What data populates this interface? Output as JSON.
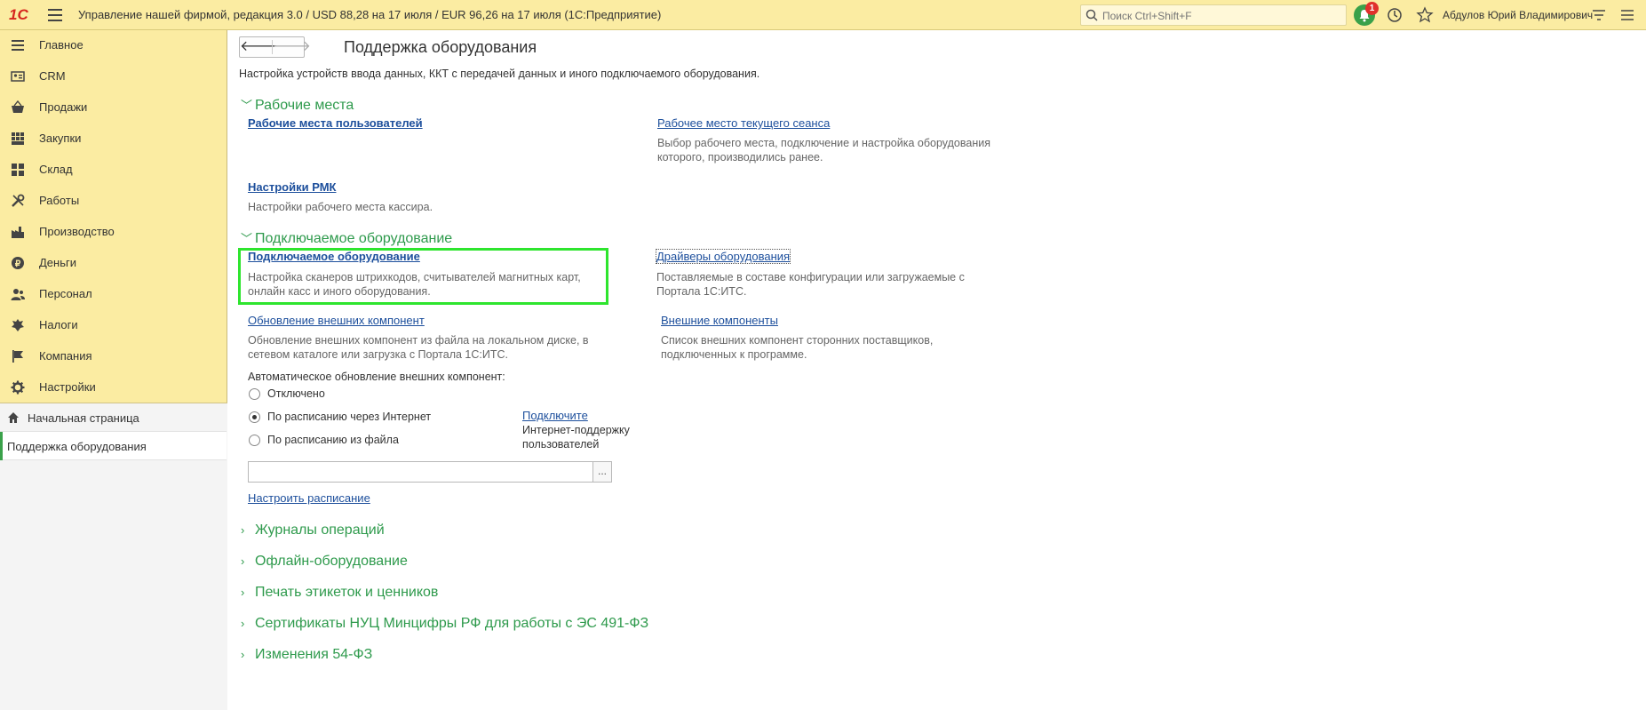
{
  "app": {
    "logo": "1С",
    "title": "Управление нашей фирмой, редакция 3.0 / USD 88,28 на 17 июля / EUR 96,26 на 17 июля  (1С:Предприятие)",
    "search_placeholder": "Поиск Ctrl+Shift+F",
    "notification_count": "1",
    "user": "Абдулов Юрий Владимирович"
  },
  "sidebar": {
    "items": [
      {
        "label": "Главное",
        "icon": "menu-icon"
      },
      {
        "label": "CRM",
        "icon": "crm-icon"
      },
      {
        "label": "Продажи",
        "icon": "sales-icon"
      },
      {
        "label": "Закупки",
        "icon": "purchases-icon"
      },
      {
        "label": "Склад",
        "icon": "warehouse-icon"
      },
      {
        "label": "Работы",
        "icon": "tools-icon"
      },
      {
        "label": "Производство",
        "icon": "factory-icon"
      },
      {
        "label": "Деньги",
        "icon": "money-icon"
      },
      {
        "label": "Персонал",
        "icon": "people-icon"
      },
      {
        "label": "Налоги",
        "icon": "taxes-icon"
      },
      {
        "label": "Компания",
        "icon": "flag-icon"
      },
      {
        "label": "Настройки",
        "icon": "gear-icon"
      }
    ],
    "open_pages": [
      {
        "label": "Начальная страница"
      },
      {
        "label": "Поддержка оборудования"
      }
    ]
  },
  "page": {
    "title": "Поддержка оборудования",
    "description": "Настройка устройств ввода данных, ККТ с передачей данных и иного подключаемого оборудования.",
    "groups": {
      "workplaces": "Рабочие места",
      "connected": "Подключаемое оборудование",
      "journals": "Журналы операций",
      "offline": "Офлайн-оборудование",
      "labels": "Печать этикеток и ценников",
      "certs": "Сертификаты НУЦ Минцифры РФ для работы с ЭС 491-ФЗ",
      "changes": "Изменения 54-ФЗ"
    },
    "workplaces": {
      "user_workplaces": "Рабочие места пользователей",
      "current_session": "Рабочее место текущего сеанса",
      "current_session_desc_1": "Выбор рабочего места, подключение и настройка оборудования",
      "current_session_desc_2": "которого, производились ранее.",
      "rmk_settings": "Настройки РМК",
      "rmk_desc": "Настройки рабочего места кассира."
    },
    "connected": {
      "equipment": "Подключаемое оборудование",
      "equipment_desc_1": "Настройка сканеров штрихкодов, считывателей магнитных карт,",
      "equipment_desc_2": "онлайн касс и иного оборудования.",
      "drivers": "Драйверы оборудования",
      "drivers_desc_1": "Поставляемые в составе конфигурации или загружаемые с",
      "drivers_desc_2": "Портала 1С:ИТС.",
      "ext_update": "Обновление внешних компонент",
      "ext_update_desc_1": "Обновление внешних компонент из файла на локальном диске, в",
      "ext_update_desc_2": "сетевом каталоге или загрузка с Портала 1С:ИТС.",
      "ext_components": "Внешние компоненты",
      "ext_components_desc_1": "Список внешних компонент сторонних поставщиков,",
      "ext_components_desc_2": "подключенных к программе.",
      "auto_update_label": "Автоматическое обновление внешних компонент:",
      "radio_off": "Отключено",
      "radio_internet": "По расписанию через Интернет",
      "radio_file": "По расписанию из файла",
      "connect_link": "Подключите",
      "connect_text_1": "Интернет-поддержку",
      "connect_text_2": "пользователей",
      "file_value": "",
      "file_button": "...",
      "schedule_link": "Настроить расписание"
    }
  },
  "colors": {
    "sidebar_bg": "#fbeca2",
    "group_green": "#2e9a4c",
    "link_blue": "#1d4f9c",
    "highlight": "#2ee52e"
  }
}
